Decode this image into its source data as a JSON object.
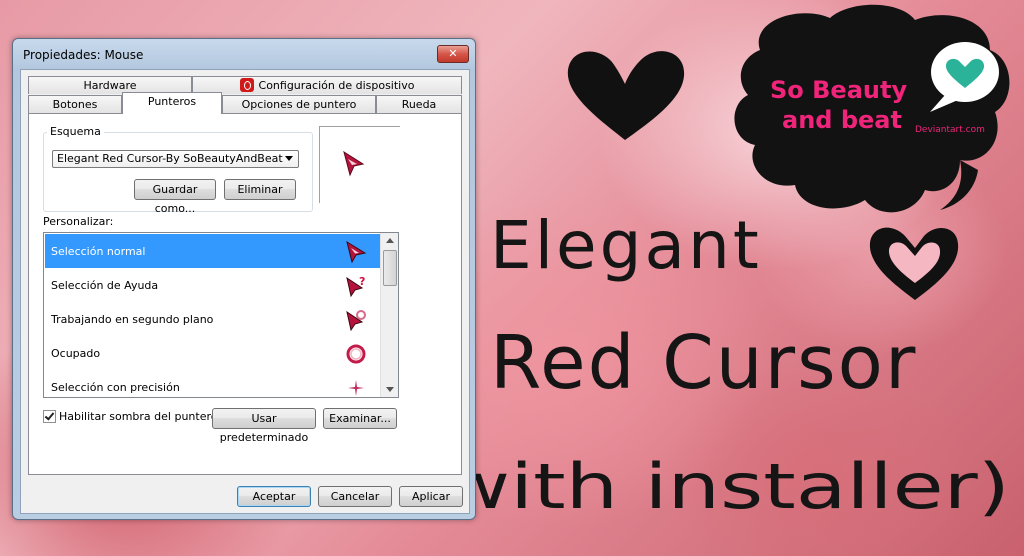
{
  "window": {
    "title": "Propiedades: Mouse",
    "close_label": "✕"
  },
  "tabs_row1": [
    {
      "label": "Hardware"
    },
    {
      "label": "Configuración de dispositivo"
    }
  ],
  "tabs_row2": [
    {
      "label": "Botones"
    },
    {
      "label": "Punteros"
    },
    {
      "label": "Opciones de puntero"
    },
    {
      "label": "Rueda"
    }
  ],
  "scheme": {
    "group_label": "Esquema",
    "selected": "Elegant Red Cursor-By SoBeautyAndBeat",
    "save_as": "Guardar como...",
    "delete": "Eliminar"
  },
  "customize": {
    "label": "Personalizar:",
    "items": [
      {
        "label": "Selección normal",
        "icon": "arrow-cursor-icon",
        "selected": true
      },
      {
        "label": "Selección de Ayuda",
        "icon": "help-cursor-icon",
        "selected": false
      },
      {
        "label": "Trabajando en segundo plano",
        "icon": "working-cursor-icon",
        "selected": false
      },
      {
        "label": "Ocupado",
        "icon": "busy-ring-icon",
        "selected": false
      },
      {
        "label": "Selección con precisión",
        "icon": "crosshair-icon",
        "selected": false
      }
    ]
  },
  "options": {
    "shadow_label": "Habilitar sombra del puntero",
    "shadow_checked": true,
    "use_default": "Usar predeterminado",
    "browse": "Examinar..."
  },
  "footer": {
    "ok": "Aceptar",
    "cancel": "Cancelar",
    "apply": "Aplicar"
  },
  "banner": {
    "logo_line1": "So Beauty",
    "logo_line2": "and beat",
    "logo_site": "Deviantart.com",
    "line1": "Elegant",
    "line2": "Red Cursor",
    "line3": "(with installer)"
  },
  "colors": {
    "accent": "#3399ff",
    "cursor_red": "#b5123c",
    "logo_pink": "#f0247a",
    "logo_teal": "#2bb39a"
  }
}
